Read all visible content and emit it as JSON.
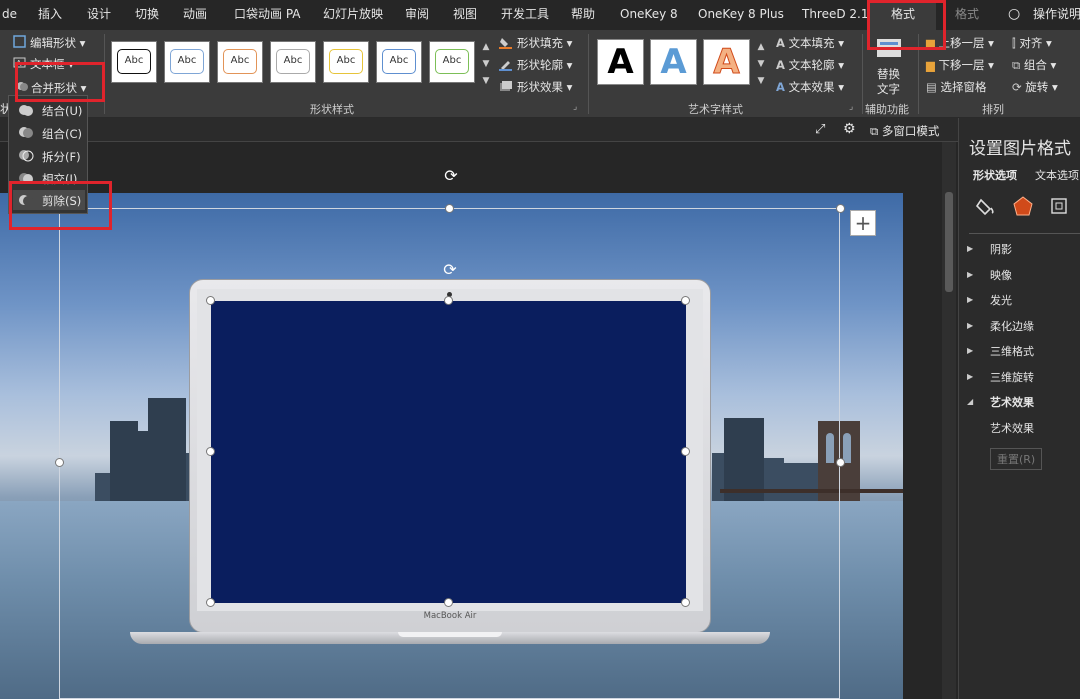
{
  "tabs": [
    "de",
    "插入",
    "设计",
    "切换",
    "动画",
    "口袋动画 PA",
    "幻灯片放映",
    "审阅",
    "视图",
    "开发工具",
    "帮助",
    "OneKey 8",
    "OneKey 8 Plus",
    "ThreeD 2.1",
    "格式",
    "格式",
    "操作说明"
  ],
  "ribbon": {
    "edit_shape": "编辑形状",
    "text_box": "文本框",
    "merge_shapes": "合并形状",
    "style_label": "Abc",
    "shape_fill": "形状填充",
    "shape_outline": "形状轮廓",
    "shape_effects": "形状效果",
    "shape_styles_group": "形状样式",
    "wordart_letter": "A",
    "text_fill": "文本填充",
    "text_outline": "文本轮廓",
    "text_effects": "文本效果",
    "wordart_group": "艺术字样式",
    "alt_text_line1": "替换",
    "alt_text_line2": "文字",
    "accessibility_group": "辅助功能",
    "bring_forward": "上移一层",
    "send_backward": "下移一层",
    "selection_pane": "选择窗格",
    "align": "对齐",
    "group": "组合",
    "rotate": "旋转",
    "arrange_group": "排列",
    "left_edge": "状"
  },
  "subbar": {
    "multi_window": "多窗口模式"
  },
  "menu": {
    "items": [
      "结合(U)",
      "组合(C)",
      "拆分(F)",
      "相交(I)",
      "剪除(S)"
    ]
  },
  "slide": {
    "laptop_brand": "MacBook Air"
  },
  "pane": {
    "title": "设置图片格式",
    "tab_shape": "形状选项",
    "tab_text": "文本选项",
    "sections": [
      "阴影",
      "映像",
      "发光",
      "柔化边缘",
      "三维格式",
      "三维旋转",
      "艺术效果"
    ],
    "sub_item": "艺术效果",
    "reset_button": "重置(R)"
  },
  "colors": {
    "highlight_red": "#e0242c",
    "screen_blue": "#0a1e5e",
    "accent_orange": "#d04a1a"
  }
}
